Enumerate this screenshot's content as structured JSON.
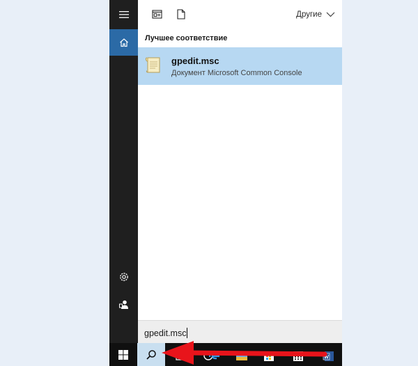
{
  "rail": {
    "icons": [
      "hamburger-menu-icon",
      "home-icon",
      "settings-icon",
      "user-icon"
    ]
  },
  "toolbar": {
    "filter_label": "Другие"
  },
  "results": {
    "section_title": "Лучшее соответствие",
    "best_match": {
      "name": "gpedit.msc",
      "subtitle": "Документ Microsoft Common Console"
    }
  },
  "search": {
    "value": "gpedit.msc"
  },
  "colors": {
    "accent": "#2b6aa6",
    "selection": "#b7d8f2",
    "arrow": "#e8141b"
  }
}
